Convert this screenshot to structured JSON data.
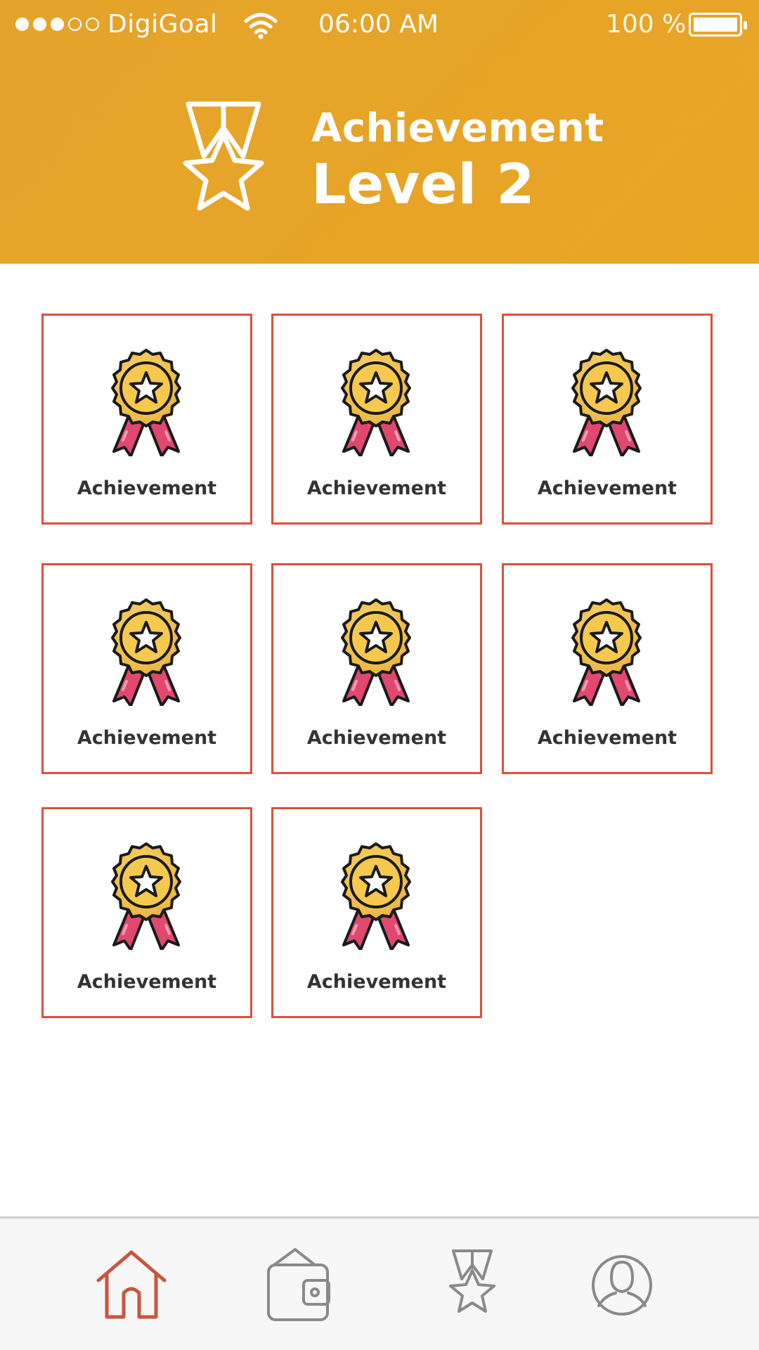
{
  "status_bar": {
    "carrier": "DigiGoal",
    "signal_filled": 3,
    "signal_total": 5,
    "time": "06:00 AM",
    "battery": "100 %"
  },
  "header": {
    "title": "Achievement",
    "subtitle": "Level 2",
    "icon": "medal-star-outline-icon",
    "background_color": "#E7A426"
  },
  "achievements": [
    {
      "label": "Achievement",
      "icon": "medal-ribbon-icon"
    },
    {
      "label": "Achievement",
      "icon": "medal-ribbon-icon"
    },
    {
      "label": "Achievement",
      "icon": "medal-ribbon-icon"
    },
    {
      "label": "Achievement",
      "icon": "medal-ribbon-icon"
    },
    {
      "label": "Achievement",
      "icon": "medal-ribbon-icon"
    },
    {
      "label": "Achievement",
      "icon": "medal-ribbon-icon"
    },
    {
      "label": "Achievement",
      "icon": "medal-ribbon-icon"
    },
    {
      "label": "Achievement",
      "icon": "medal-ribbon-icon"
    }
  ],
  "card_border_color": "#D9513D",
  "bottom_nav": {
    "items": [
      {
        "name": "home",
        "icon": "home-icon",
        "active": true
      },
      {
        "name": "wallet",
        "icon": "wallet-icon",
        "active": false
      },
      {
        "name": "achievements",
        "icon": "medal-star-icon",
        "active": false
      },
      {
        "name": "profile",
        "icon": "user-icon",
        "active": false
      }
    ],
    "active_color": "#C9553F",
    "inactive_color": "#8A8A8A"
  }
}
